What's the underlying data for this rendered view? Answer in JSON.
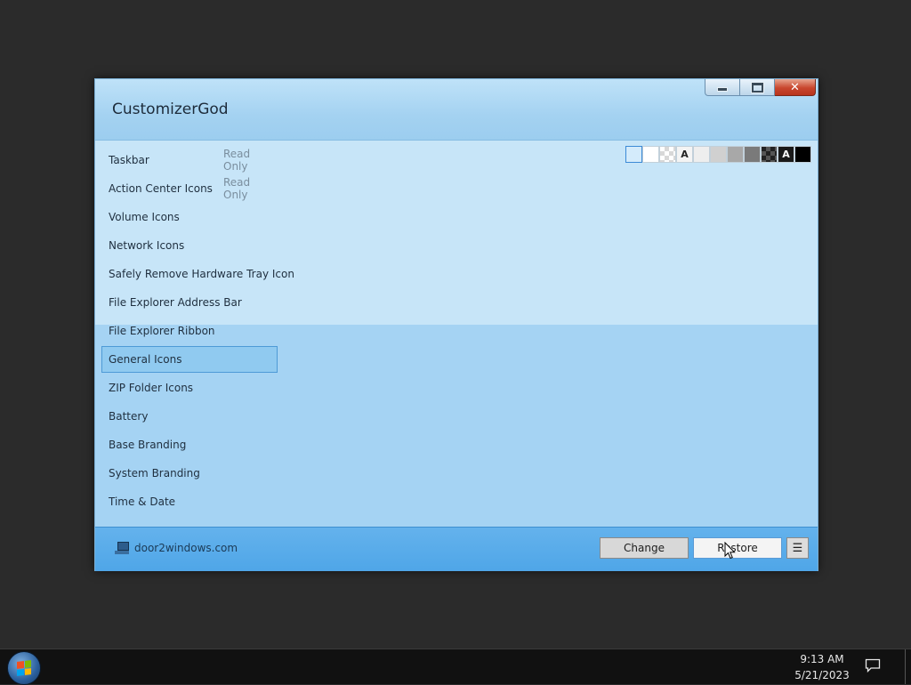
{
  "window": {
    "title": "CustomizerGod",
    "caption": {
      "minimize_icon": "minimize-icon",
      "maximize_icon": "maximize-icon",
      "close_icon": "close-icon",
      "close_glyph": "x"
    }
  },
  "list": {
    "items": [
      {
        "label": "Taskbar",
        "tag": "Read Only",
        "selected": false
      },
      {
        "label": "Action Center Icons",
        "tag": "Read Only",
        "selected": false
      },
      {
        "label": "Volume Icons",
        "tag": "",
        "selected": false
      },
      {
        "label": "Network Icons",
        "tag": "",
        "selected": false
      },
      {
        "label": "Safely Remove Hardware Tray Icon",
        "tag": "",
        "selected": false
      },
      {
        "label": "File Explorer Address Bar",
        "tag": "",
        "selected": false
      },
      {
        "label": "File Explorer Ribbon",
        "tag": "",
        "selected": false
      },
      {
        "label": "General Icons",
        "tag": "",
        "selected": true
      },
      {
        "label": "ZIP Folder Icons",
        "tag": "",
        "selected": false
      },
      {
        "label": "Battery",
        "tag": "",
        "selected": false
      },
      {
        "label": "Base Branding",
        "tag": "",
        "selected": false
      },
      {
        "label": "System Branding",
        "tag": "",
        "selected": false
      },
      {
        "label": "Time & Date",
        "tag": "",
        "selected": false
      }
    ]
  },
  "swatches": [
    {
      "kind": "light-blue",
      "text": "",
      "color": "#d4ebfb",
      "selected": true
    },
    {
      "kind": "white",
      "text": "",
      "color": "#ffffff",
      "selected": false
    },
    {
      "kind": "checker-light",
      "text": "",
      "color": "",
      "selected": false
    },
    {
      "kind": "letter",
      "text": "A",
      "color": "#f4f4f4",
      "text_color": "#222222",
      "selected": false
    },
    {
      "kind": "light-gray",
      "text": "",
      "color": "#eeeeee",
      "selected": false
    },
    {
      "kind": "gray",
      "text": "",
      "color": "#d0d0d0",
      "selected": false
    },
    {
      "kind": "mid-gray",
      "text": "",
      "color": "#a8a8a8",
      "selected": false
    },
    {
      "kind": "dark-gray",
      "text": "",
      "color": "#7a7a7a",
      "selected": false
    },
    {
      "kind": "checker-dark",
      "text": "",
      "color": "",
      "selected": false
    },
    {
      "kind": "letter-dark",
      "text": "A",
      "color": "#1a1a1a",
      "text_color": "#ffffff",
      "selected": false
    },
    {
      "kind": "black",
      "text": "",
      "color": "#000000",
      "selected": false
    }
  ],
  "footer": {
    "site_icon": "computer-icon",
    "site_text": "door2windows.com",
    "change_label": "Change",
    "restore_label": "Restore",
    "menu_label": "☰"
  },
  "taskbar": {
    "start_icon": "windows-logo-icon",
    "time": "9:13 AM",
    "date": "5/21/2023",
    "notify_icon": "action-center-icon"
  },
  "colors": {
    "accent": "#4fa6e8",
    "window_bg": "#a9d3f1",
    "selection": "#90caf0"
  }
}
